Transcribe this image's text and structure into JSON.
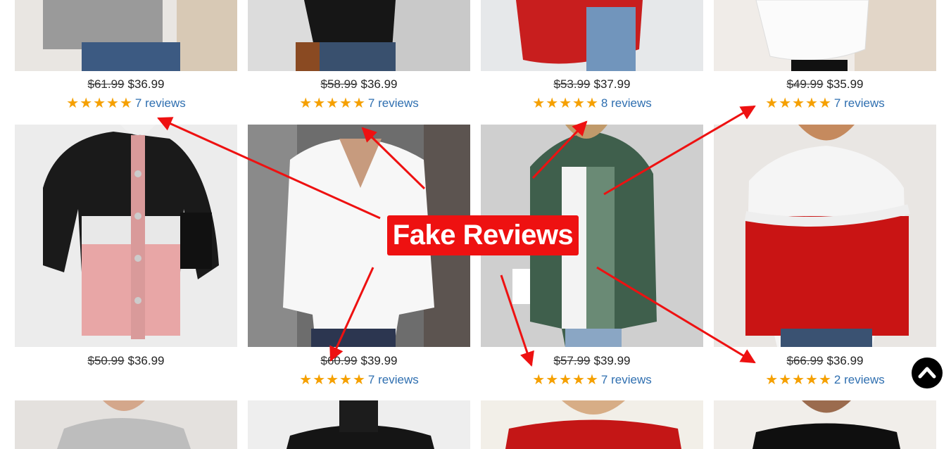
{
  "products": [
    {
      "old_price": "$61.99",
      "price": "$36.99",
      "stars": "★★★★★",
      "reviews": "7 reviews"
    },
    {
      "old_price": "$58.99",
      "price": "$36.99",
      "stars": "★★★★★",
      "reviews": "7 reviews"
    },
    {
      "old_price": "$53.99",
      "price": "$37.99",
      "stars": "★★★★★",
      "reviews": "8 reviews"
    },
    {
      "old_price": "$49.99",
      "price": "$35.99",
      "stars": "★★★★★",
      "reviews": "7 reviews"
    },
    {
      "old_price": "$50.99",
      "price": "$36.99"
    },
    {
      "old_price": "$60.99",
      "price": "$39.99",
      "stars": "★★★★★",
      "reviews": "7 reviews"
    },
    {
      "old_price": "$57.99",
      "price": "$39.99",
      "stars": "★★★★★",
      "reviews": "7 reviews"
    },
    {
      "old_price": "$66.99",
      "price": "$36.99",
      "stars": "★★★★★",
      "reviews": "2 reviews"
    }
  ],
  "annotation": {
    "label": "Fake Reviews",
    "color": "#ee1111"
  },
  "scroll_top_icon": "chevron-up-icon",
  "colors": {
    "star": "#f5a000",
    "review_link": "#2f6fb0"
  }
}
